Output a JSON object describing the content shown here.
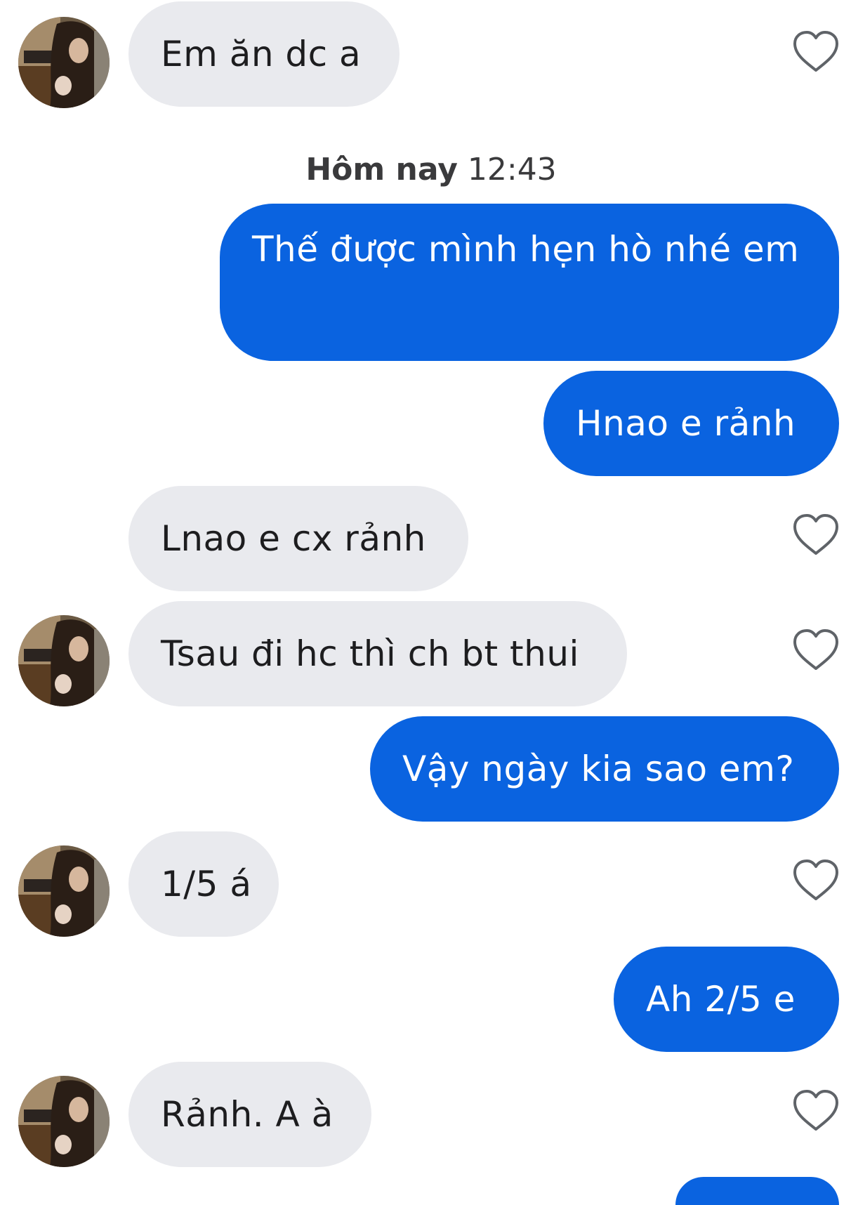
{
  "conversation": {
    "timestamp": {
      "day": "Hôm nay",
      "time": "12:43"
    },
    "messages": [
      {
        "from": "them",
        "text": "Em ăn dc a"
      },
      {
        "from": "me",
        "text": "Thế được mình hẹn hò nhé em"
      },
      {
        "from": "me",
        "text": "Hnao e rảnh"
      },
      {
        "from": "them",
        "text": "Lnao e cx rảnh"
      },
      {
        "from": "them",
        "text": "Tsau đi hc thì ch bt thui"
      },
      {
        "from": "me",
        "text": "Vậy ngày kia sao em?"
      },
      {
        "from": "them",
        "text": "1/5 á"
      },
      {
        "from": "me",
        "text": "Ah 2/5 e"
      },
      {
        "from": "them",
        "text": "Rảnh. A à"
      }
    ]
  },
  "colors": {
    "outgoing_bubble": "#0a63e0",
    "incoming_bubble": "#e9eaee",
    "heart_outline": "#5f6368"
  },
  "icons": {
    "like": "heart-outline-icon",
    "avatar": "contact-avatar"
  }
}
